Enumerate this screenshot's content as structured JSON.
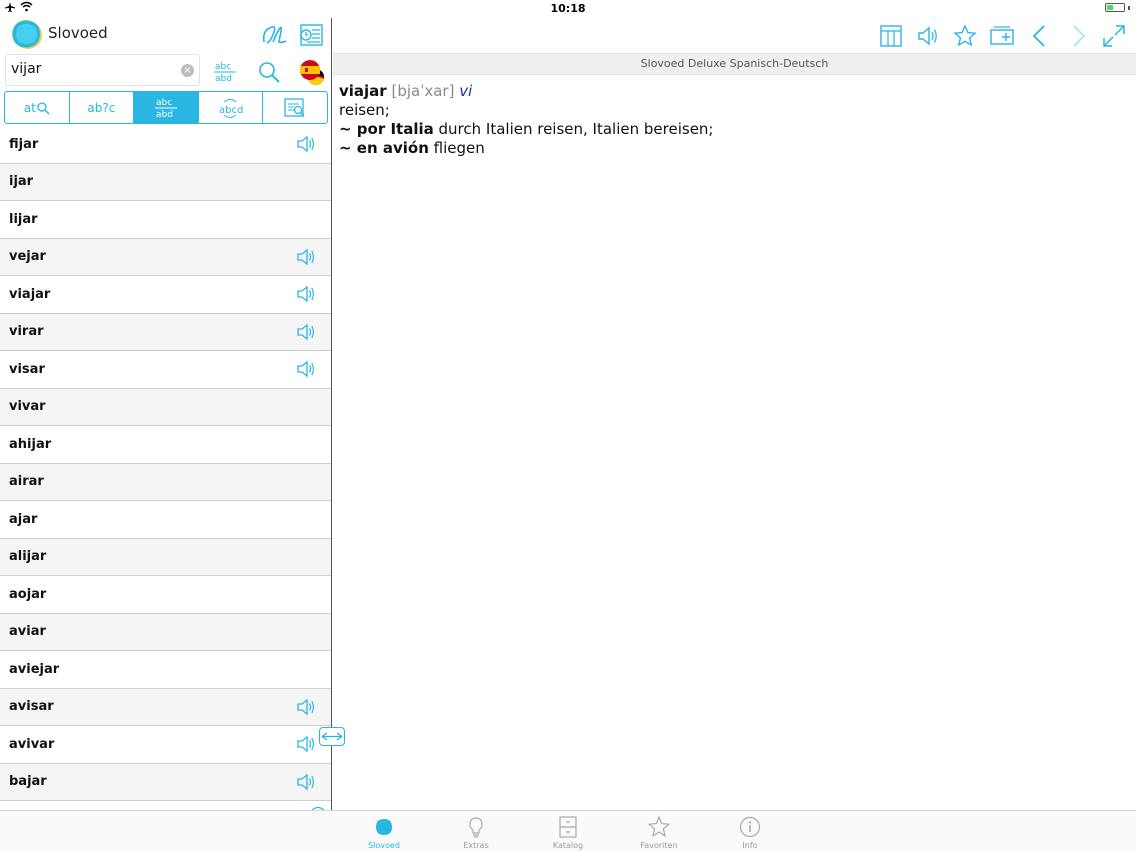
{
  "status_bar": {
    "time": "10:18"
  },
  "app": {
    "name": "Slovoed"
  },
  "search": {
    "value": "vijar",
    "placeholder": ""
  },
  "modes": [
    {
      "label": "at",
      "icon": "search-icon",
      "active": false
    },
    {
      "label": "ab?c",
      "icon": "wildcard-icon",
      "active": false
    },
    {
      "label": "abc/abd",
      "icon": "fuzzy-icon",
      "active": true
    },
    {
      "label": "abcd",
      "icon": "anagram-icon",
      "active": false
    },
    {
      "label": "",
      "icon": "fulltext-search-icon",
      "active": false
    }
  ],
  "words": [
    {
      "text": "fijar",
      "audio": true
    },
    {
      "text": "ijar",
      "audio": false
    },
    {
      "text": "lijar",
      "audio": false
    },
    {
      "text": "vejar",
      "audio": true
    },
    {
      "text": "viajar",
      "audio": true
    },
    {
      "text": "virar",
      "audio": true
    },
    {
      "text": "visar",
      "audio": true
    },
    {
      "text": "vivar",
      "audio": false
    },
    {
      "text": "ahijar",
      "audio": false
    },
    {
      "text": "airar",
      "audio": false
    },
    {
      "text": "ajar",
      "audio": false
    },
    {
      "text": "alijar",
      "audio": false
    },
    {
      "text": "aojar",
      "audio": false
    },
    {
      "text": "aviar",
      "audio": false
    },
    {
      "text": "aviejar",
      "audio": false
    },
    {
      "text": "avisar",
      "audio": true
    },
    {
      "text": "avivar",
      "audio": true
    },
    {
      "text": "bajar",
      "audio": true
    }
  ],
  "dictionary": {
    "title": "Slovoed Deluxe Spanisch-Deutsch"
  },
  "entry": {
    "headword": "viajar",
    "transcription": "[bjaˈxar]",
    "pos": "vi",
    "translation": "reisen;",
    "examples": [
      {
        "phrase": "~ por Italia",
        "translation": "durch Italien reisen, Italien bereisen;"
      },
      {
        "phrase": "~ en avión",
        "translation": "fliegen"
      }
    ]
  },
  "tabs": [
    {
      "label": "Slovoed",
      "icon": "slovoed-icon",
      "active": true
    },
    {
      "label": "Extras",
      "icon": "lightbulb-icon",
      "active": false
    },
    {
      "label": "Katalog",
      "icon": "cabinet-icon",
      "active": false
    },
    {
      "label": "Favoriten",
      "icon": "star-icon",
      "active": false
    },
    {
      "label": "Info",
      "icon": "info-icon",
      "active": false
    }
  ],
  "colors": {
    "accent": "#29b6e3",
    "pos": "#1a2fa8",
    "transcription": "#8a8a8a"
  }
}
